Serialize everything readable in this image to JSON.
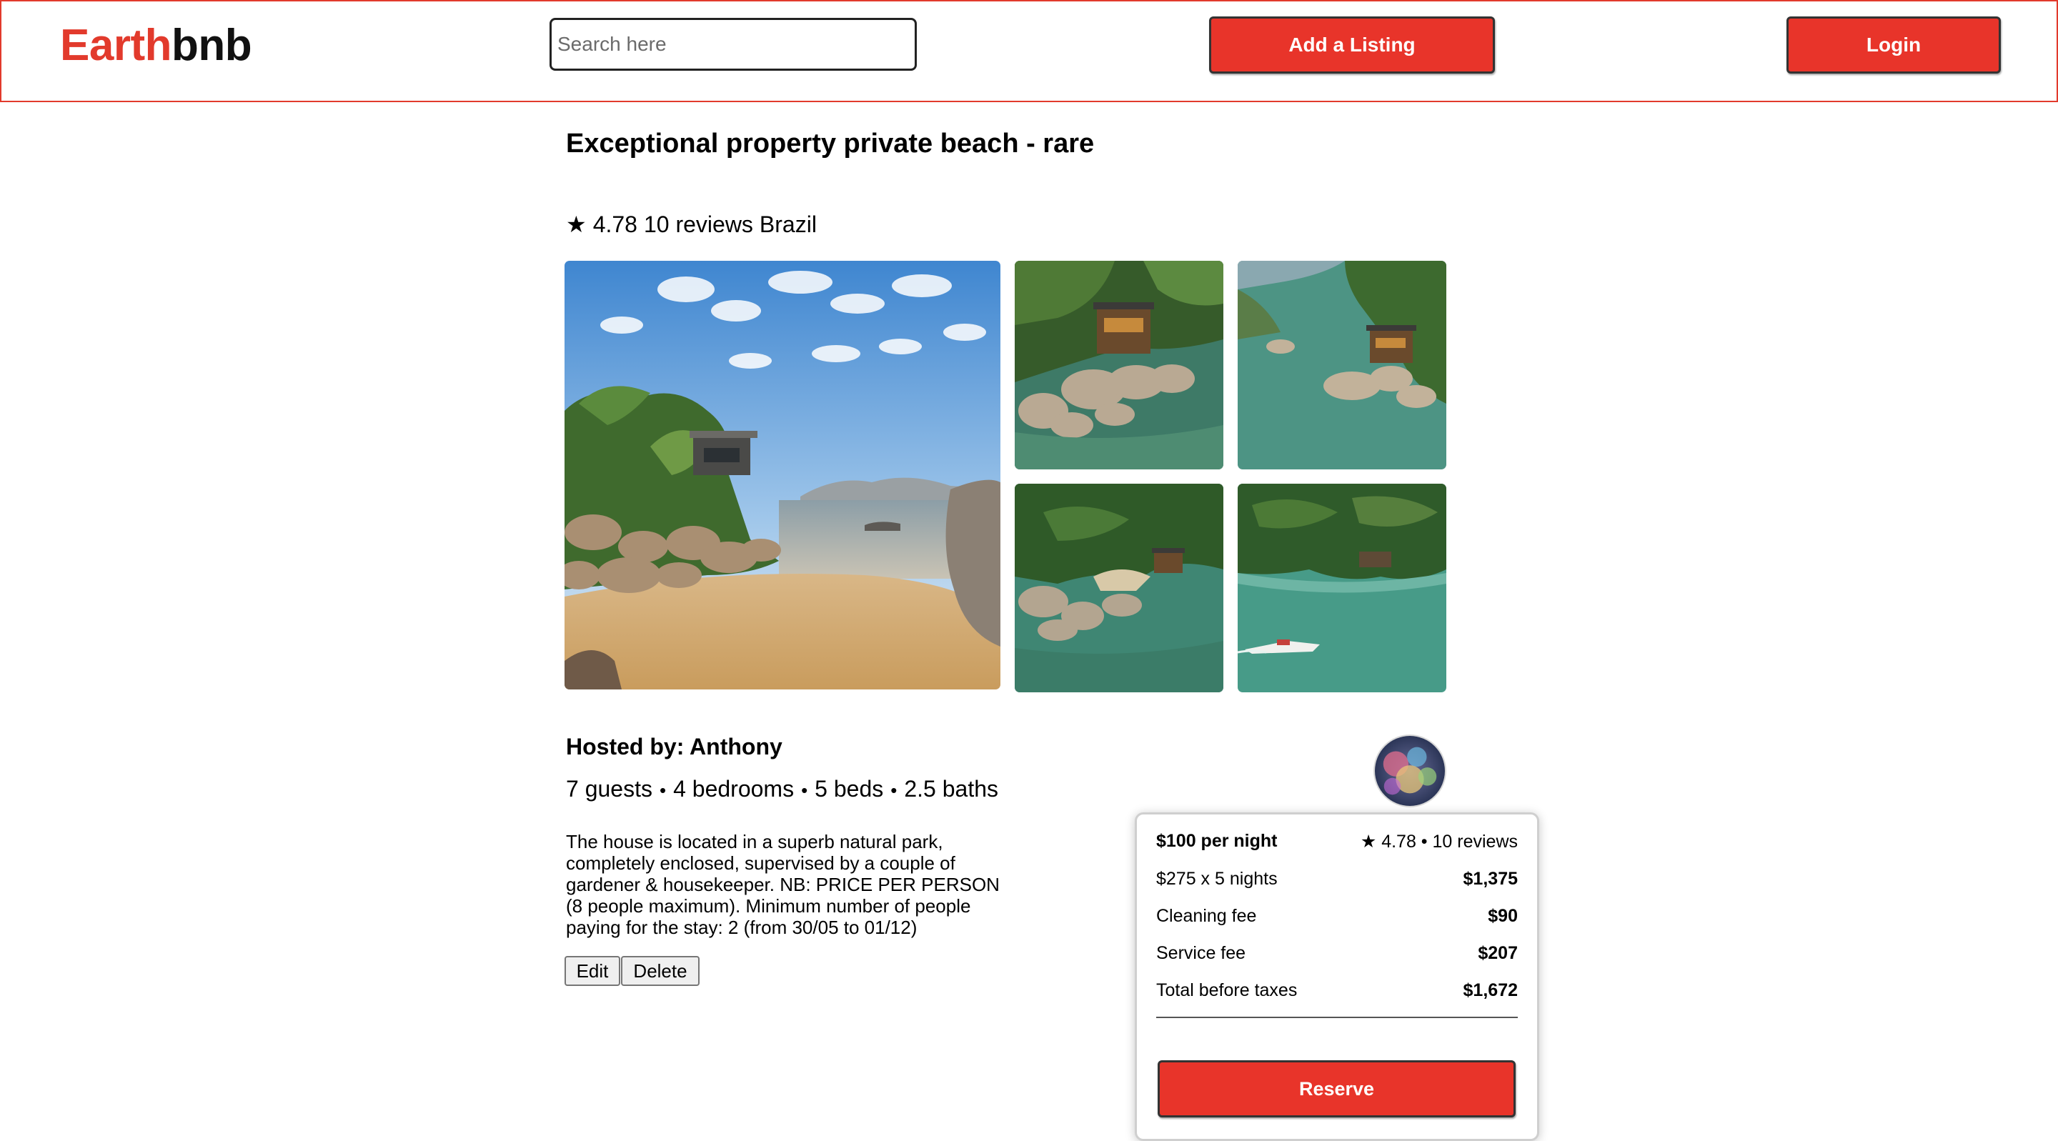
{
  "header": {
    "logo_part1": "Earth",
    "logo_part2": "bnb",
    "search_placeholder": "Search here",
    "add_listing_label": "Add a Listing",
    "login_label": "Login"
  },
  "listing": {
    "title": "Exceptional property private beach - rare",
    "star_icon": "★",
    "rating": "4.78",
    "reviews": "10 reviews",
    "location": "Brazil",
    "host": "Hosted by: Anthony",
    "specs": [
      "7 guests",
      "4 bedrooms",
      "5 beds",
      "2.5 baths"
    ],
    "separator": "•",
    "description": "The house is located in a superb natural park, completely enclosed, supervised by a couple of gardener & housekeeper. NB: PRICE PER PERSON (8 people maximum). Minimum number of people paying for the stay: 2 (from 30/05 to 01/12)",
    "edit_label": "Edit",
    "delete_label": "Delete",
    "photos": [
      "beach-house-photo",
      "aerial-house-rocks-photo",
      "aerial-coast-photo",
      "aerial-bay-photo",
      "aerial-boat-photo"
    ]
  },
  "booking": {
    "price_per_night": "$100 per night",
    "rating_summary": "★ 4.78 • 10 reviews",
    "nights_label": "$275 x 5 nights",
    "nights_value": "$1,375",
    "cleaning_label": "Cleaning fee",
    "cleaning_value": "$90",
    "service_label": "Service fee",
    "service_value": "$207",
    "total_label": "Total before taxes",
    "total_value": "$1,672",
    "reserve_label": "Reserve"
  },
  "colors": {
    "brand_red": "#e23a2c",
    "button_red": "#e8342a"
  }
}
